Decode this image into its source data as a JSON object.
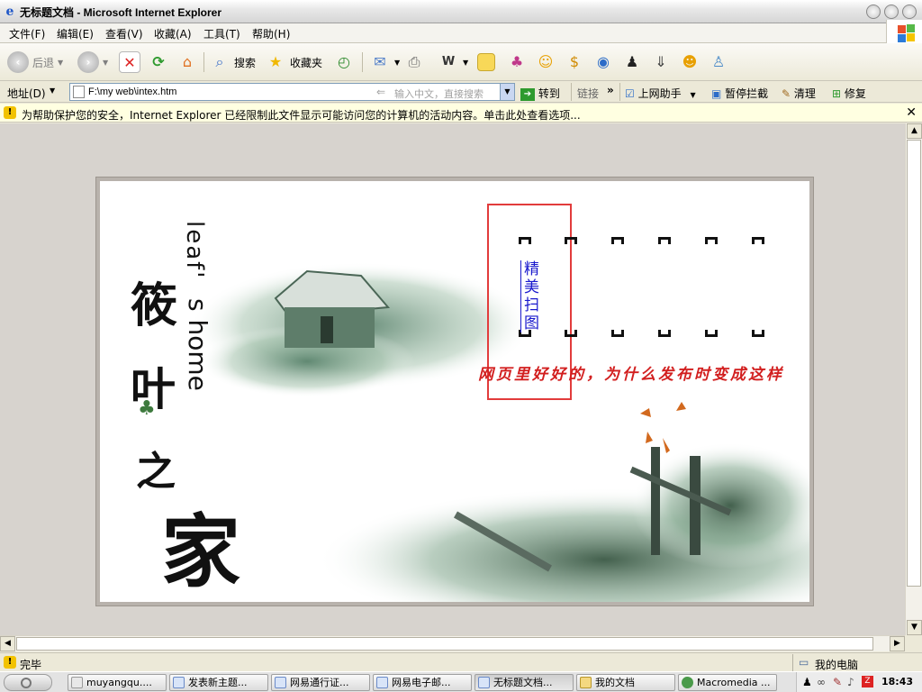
{
  "window": {
    "title": "无标题文档 - Microsoft Internet Explorer"
  },
  "menu": {
    "items": [
      "文件(F)",
      "编辑(E)",
      "查看(V)",
      "收藏(A)",
      "工具(T)",
      "帮助(H)"
    ]
  },
  "toolbar": {
    "back_label": "后退",
    "search_label": "搜索",
    "favorites_label": "收藏夹"
  },
  "address": {
    "label": "地址(D)",
    "url": "F:\\my web\\intex.htm",
    "placeholder": "输入中文，直接搜索",
    "go_label": "转到",
    "links_label": "链接",
    "extras": [
      "上网助手",
      "暂停拦截",
      "清理",
      "修复"
    ]
  },
  "infobar": {
    "message": "为帮助保护您的安全，Internet Explorer 已经限制此文件显示可能访问您的计算机的活动内容。单击此处查看选项..."
  },
  "page": {
    "logo_en_1": "leaf'",
    "logo_en_2": "s home",
    "logo_cn": [
      "筱",
      "叶",
      "之",
      "家"
    ],
    "nav_link": "精美扫图",
    "note": "网页里好好的，为什么发布时变成这样"
  },
  "status": {
    "left": "完毕",
    "zone": "我的电脑"
  },
  "taskbar": {
    "tasks": [
      "muyangqu....",
      "发表新主题...",
      "网易通行证...",
      "网易电子邮...",
      "无标题文档...",
      "我的文档",
      "Macromedia ..."
    ],
    "clock": "18:43"
  },
  "colors": {
    "accent_red": "#E23C3C",
    "link_blue": "#1A1ACD",
    "ink_green": "#3E7A3E"
  }
}
